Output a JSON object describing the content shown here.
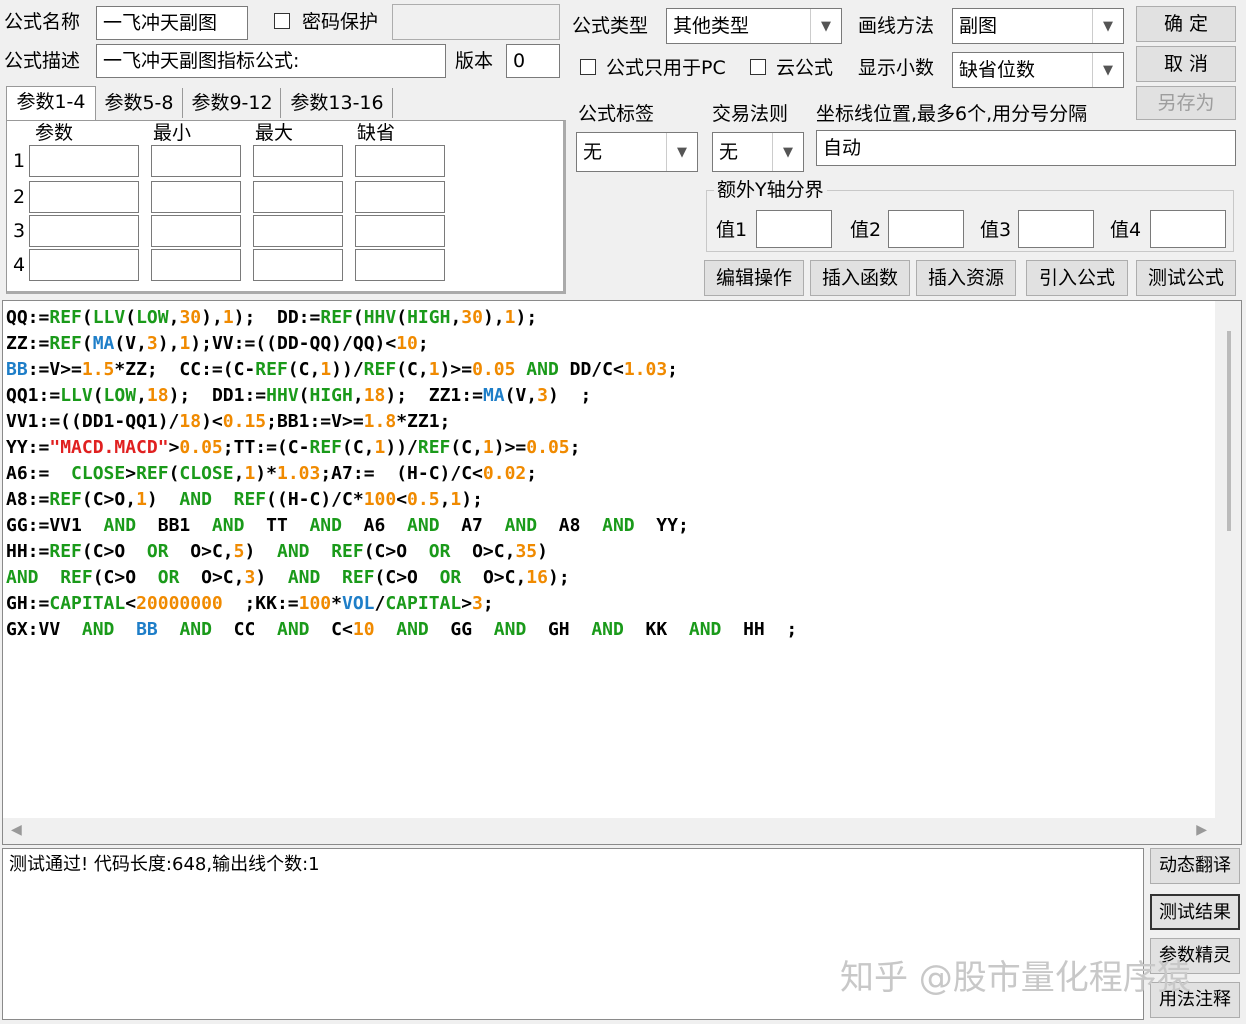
{
  "top": {
    "name_label": "公式名称",
    "name_value": "一飞冲天副图",
    "password_label": "密码保护",
    "desc_label": "公式描述",
    "desc_value": "一飞冲天副图指标公式:",
    "version_label": "版本",
    "version_value": "0",
    "type_label": "公式类型",
    "type_value": "其他类型",
    "draw_label": "画线方法",
    "draw_value": "副图",
    "pc_only_label": "公式只用于PC",
    "cloud_label": "云公式",
    "decimals_label": "显示小数",
    "decimals_value": "缺省位数",
    "ok": "确  定",
    "cancel": "取  消",
    "save_as": "另存为"
  },
  "tabs": [
    "参数1-4",
    "参数5-8",
    "参数9-12",
    "参数13-16"
  ],
  "params": {
    "headers": [
      "参数",
      "最小",
      "最大",
      "缺省"
    ],
    "rows": [
      "1",
      "2",
      "3",
      "4"
    ]
  },
  "right": {
    "tag_label": "公式标签",
    "tag_value": "无",
    "trade_label": "交易法则",
    "trade_value": "无",
    "axis_label": "坐标线位置,最多6个,用分号分隔",
    "axis_value": "自动",
    "yaxis_group": "额外Y轴分界",
    "y_labels": [
      "值1",
      "值2",
      "值3",
      "值4"
    ]
  },
  "actions": [
    "编辑操作",
    "插入函数",
    "插入资源",
    "引入公式",
    "测试公式"
  ],
  "code_lines": [
    [
      [
        "d",
        "QQ:="
      ],
      [
        "g",
        "REF"
      ],
      [
        "d",
        "("
      ],
      [
        "g",
        "LLV"
      ],
      [
        "d",
        "("
      ],
      [
        "g",
        "LOW"
      ],
      [
        "d",
        ","
      ],
      [
        "o",
        "30"
      ],
      [
        "d",
        "),"
      ],
      [
        "o",
        "1"
      ],
      [
        "d",
        ");  DD:="
      ],
      [
        "g",
        "REF"
      ],
      [
        "d",
        "("
      ],
      [
        "g",
        "HHV"
      ],
      [
        "d",
        "("
      ],
      [
        "g",
        "HIGH"
      ],
      [
        "d",
        ","
      ],
      [
        "o",
        "30"
      ],
      [
        "d",
        "),"
      ],
      [
        "o",
        "1"
      ],
      [
        "d",
        ");"
      ]
    ],
    [
      [
        "d",
        "ZZ:="
      ],
      [
        "g",
        "REF"
      ],
      [
        "d",
        "("
      ],
      [
        "b",
        "MA"
      ],
      [
        "d",
        "(V,"
      ],
      [
        "o",
        "3"
      ],
      [
        "d",
        "),"
      ],
      [
        "o",
        "1"
      ],
      [
        "d",
        ");VV:=((DD-QQ)/QQ)<"
      ],
      [
        "o",
        "10"
      ],
      [
        "d",
        ";"
      ]
    ],
    [
      [
        "b",
        "BB"
      ],
      [
        "d",
        ":=V>="
      ],
      [
        "o",
        "1.5"
      ],
      [
        "d",
        "*ZZ;  CC:=(C-"
      ],
      [
        "g",
        "REF"
      ],
      [
        "d",
        "(C,"
      ],
      [
        "o",
        "1"
      ],
      [
        "d",
        "))/"
      ],
      [
        "g",
        "REF"
      ],
      [
        "d",
        "(C,"
      ],
      [
        "o",
        "1"
      ],
      [
        "d",
        ")>="
      ],
      [
        "o",
        "0.05"
      ],
      [
        "d",
        " "
      ],
      [
        "g",
        "AND"
      ],
      [
        "d",
        " DD/C<"
      ],
      [
        "o",
        "1.03"
      ],
      [
        "d",
        ";"
      ]
    ],
    [
      [
        "d",
        "QQ1:="
      ],
      [
        "g",
        "LLV"
      ],
      [
        "d",
        "("
      ],
      [
        "g",
        "LOW"
      ],
      [
        "d",
        ","
      ],
      [
        "o",
        "18"
      ],
      [
        "d",
        ");  DD1:="
      ],
      [
        "g",
        "HHV"
      ],
      [
        "d",
        "("
      ],
      [
        "g",
        "HIGH"
      ],
      [
        "d",
        ","
      ],
      [
        "o",
        "18"
      ],
      [
        "d",
        ");  ZZ1:="
      ],
      [
        "b",
        "MA"
      ],
      [
        "d",
        "(V,"
      ],
      [
        "o",
        "3"
      ],
      [
        "d",
        ")  ;"
      ]
    ],
    [
      [
        "d",
        "VV1:=((DD1-QQ1)/"
      ],
      [
        "o",
        "18"
      ],
      [
        "d",
        ")<"
      ],
      [
        "o",
        "0.15"
      ],
      [
        "d",
        ";BB1:=V>="
      ],
      [
        "o",
        "1.8"
      ],
      [
        "d",
        "*ZZ1;"
      ]
    ],
    [
      [
        "d",
        "YY:="
      ],
      [
        "r",
        "\"MACD.MACD\""
      ],
      [
        "d",
        ">"
      ],
      [
        "o",
        "0.05"
      ],
      [
        "d",
        ";TT:=(C-"
      ],
      [
        "g",
        "REF"
      ],
      [
        "d",
        "(C,"
      ],
      [
        "o",
        "1"
      ],
      [
        "d",
        "))/"
      ],
      [
        "g",
        "REF"
      ],
      [
        "d",
        "(C,"
      ],
      [
        "o",
        "1"
      ],
      [
        "d",
        ")>="
      ],
      [
        "o",
        "0.05"
      ],
      [
        "d",
        ";"
      ]
    ],
    [
      [
        "d",
        "A6:=  "
      ],
      [
        "g",
        "CLOSE"
      ],
      [
        "d",
        ">"
      ],
      [
        "g",
        "REF"
      ],
      [
        "d",
        "("
      ],
      [
        "g",
        "CLOSE"
      ],
      [
        "d",
        ","
      ],
      [
        "o",
        "1"
      ],
      [
        "d",
        ")*"
      ],
      [
        "o",
        "1.03"
      ],
      [
        "d",
        ";A7:=  (H-C)/C<"
      ],
      [
        "o",
        "0.02"
      ],
      [
        "d",
        ";"
      ]
    ],
    [
      [
        "d",
        "A8:="
      ],
      [
        "g",
        "REF"
      ],
      [
        "d",
        "(C>O,"
      ],
      [
        "o",
        "1"
      ],
      [
        "d",
        ")  "
      ],
      [
        "g",
        "AND"
      ],
      [
        "d",
        "  "
      ],
      [
        "g",
        "REF"
      ],
      [
        "d",
        "((H-C)/C*"
      ],
      [
        "o",
        "100"
      ],
      [
        "d",
        "<"
      ],
      [
        "o",
        "0.5"
      ],
      [
        "d",
        ","
      ],
      [
        "o",
        "1"
      ],
      [
        "d",
        ");"
      ]
    ],
    [
      [
        "d",
        "GG:=VV1  "
      ],
      [
        "g",
        "AND"
      ],
      [
        "d",
        "  BB1  "
      ],
      [
        "g",
        "AND"
      ],
      [
        "d",
        "  TT  "
      ],
      [
        "g",
        "AND"
      ],
      [
        "d",
        "  A6  "
      ],
      [
        "g",
        "AND"
      ],
      [
        "d",
        "  A7  "
      ],
      [
        "g",
        "AND"
      ],
      [
        "d",
        "  A8  "
      ],
      [
        "g",
        "AND"
      ],
      [
        "d",
        "  YY;"
      ]
    ],
    [
      [
        "d",
        "HH:="
      ],
      [
        "g",
        "REF"
      ],
      [
        "d",
        "(C>O  "
      ],
      [
        "g",
        "OR"
      ],
      [
        "d",
        "  O>C,"
      ],
      [
        "o",
        "5"
      ],
      [
        "d",
        ")  "
      ],
      [
        "g",
        "AND"
      ],
      [
        "d",
        "  "
      ],
      [
        "g",
        "REF"
      ],
      [
        "d",
        "(C>O  "
      ],
      [
        "g",
        "OR"
      ],
      [
        "d",
        "  O>C,"
      ],
      [
        "o",
        "35"
      ],
      [
        "d",
        ")"
      ]
    ],
    [
      [
        "g",
        "AND"
      ],
      [
        "d",
        "  "
      ],
      [
        "g",
        "REF"
      ],
      [
        "d",
        "(C>O  "
      ],
      [
        "g",
        "OR"
      ],
      [
        "d",
        "  O>C,"
      ],
      [
        "o",
        "3"
      ],
      [
        "d",
        ")  "
      ],
      [
        "g",
        "AND"
      ],
      [
        "d",
        "  "
      ],
      [
        "g",
        "REF"
      ],
      [
        "d",
        "(C>O  "
      ],
      [
        "g",
        "OR"
      ],
      [
        "d",
        "  O>C,"
      ],
      [
        "o",
        "16"
      ],
      [
        "d",
        ");"
      ]
    ],
    [
      [
        "d",
        "GH:="
      ],
      [
        "g",
        "CAPITAL"
      ],
      [
        "d",
        "<"
      ],
      [
        "o",
        "20000000"
      ],
      [
        "d",
        "  ;KK:="
      ],
      [
        "o",
        "100"
      ],
      [
        "d",
        "*"
      ],
      [
        "b",
        "VOL"
      ],
      [
        "d",
        "/"
      ],
      [
        "g",
        "CAPITAL"
      ],
      [
        "d",
        ">"
      ],
      [
        "o",
        "3"
      ],
      [
        "d",
        ";"
      ]
    ],
    [
      [
        "d",
        "GX:VV  "
      ],
      [
        "g",
        "AND"
      ],
      [
        "d",
        "  "
      ],
      [
        "b",
        "BB"
      ],
      [
        "d",
        "  "
      ],
      [
        "g",
        "AND"
      ],
      [
        "d",
        "  CC  "
      ],
      [
        "g",
        "AND"
      ],
      [
        "d",
        "  C<"
      ],
      [
        "o",
        "10"
      ],
      [
        "d",
        "  "
      ],
      [
        "g",
        "AND"
      ],
      [
        "d",
        "  GG  "
      ],
      [
        "g",
        "AND"
      ],
      [
        "d",
        "  GH  "
      ],
      [
        "g",
        "AND"
      ],
      [
        "d",
        "  KK  "
      ],
      [
        "g",
        "AND"
      ],
      [
        "d",
        "  HH  ;"
      ]
    ]
  ],
  "output": {
    "message": "测试通过! 代码长度:648,输出线个数:1"
  },
  "side_buttons": [
    "动态翻译",
    "测试结果",
    "参数精灵",
    "用法注释"
  ],
  "watermark": "知乎 @股市量化程序猿"
}
